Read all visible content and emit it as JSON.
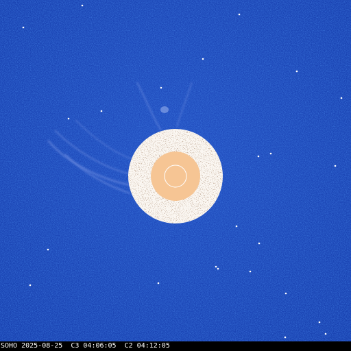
{
  "image": {
    "caption": "SOHO 2025-08-25  C3 04:06:05  C2 04:12:05"
  },
  "colors": {
    "sky": "#1d47b8",
    "sky_dark": "#0f2f9a",
    "occulter_ring": "#fbf7f2",
    "occulter_speckle": "#4a2a14",
    "sun_disk": "#f6c594",
    "sun_outline": "#ffffff",
    "star": "#ffffff",
    "caption_text": "#ffffff",
    "caption_bg": "#000000"
  }
}
